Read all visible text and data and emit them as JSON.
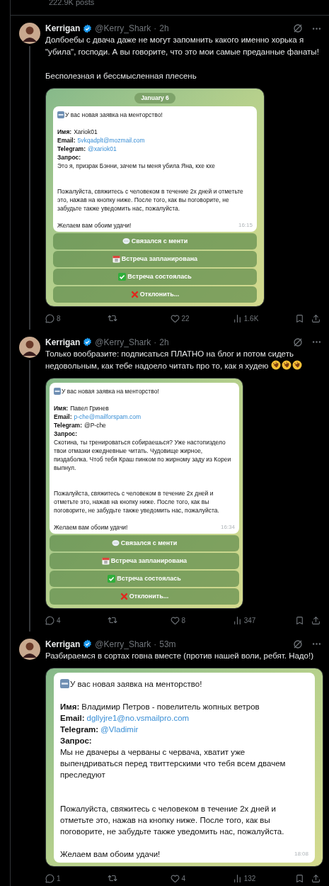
{
  "header": {
    "posts": "222.9K posts"
  },
  "tweets": [
    {
      "author": "Kerrigan",
      "verified": true,
      "handle": "@Kerry_Shark",
      "dot": "·",
      "time": "2h",
      "thread_line": true,
      "paragraphs": [
        "Долбоебы с двача даже не могут запомнить какого именно хорька я \"убила\", господи. А вы говорите, что это мои самые преданные фанаты!",
        "Бесполезная и бессмысленная плесень"
      ],
      "message": {
        "date": "January 6",
        "title": "У вас новая заявка на менторство!",
        "fields": [
          {
            "label": "Имя:",
            "value": "Xariok01",
            "link": false
          },
          {
            "label": "Email:",
            "value": "5vkqadplt@mozmail.com",
            "link": true
          },
          {
            "label": "Telegram:",
            "value": "@xariok01",
            "link": true
          }
        ],
        "request_label": "Запрос:",
        "request": "Это я, призрак Бэнни, зачем ты меня убила Яна, кхе кхе",
        "body": "Пожалуйста, свяжитесь с человеком в течение 2х дней и отметьте это, нажав на кнопку ниже. После того, как вы поговорите, не забудьте также уведомить нас, пожалуйста.",
        "closing": "Желаем вам обоим удачи!",
        "time": "16:15",
        "buttons": [
          {
            "kind": "chat",
            "label": "Связался с менти"
          },
          {
            "kind": "calendar",
            "label": "Встреча запланирована"
          },
          {
            "kind": "check",
            "label": "Встреча состоялась"
          },
          {
            "kind": "cross",
            "label": "Отклонить..."
          }
        ]
      },
      "stats": {
        "replies": "8",
        "likes": "22",
        "views": "1.6K"
      }
    },
    {
      "author": "Kerrigan",
      "verified": true,
      "handle": "@Kerry_Shark",
      "dot": "·",
      "time": "2h",
      "thread_line": true,
      "paragraphs": [
        "Только вообразите: подписаться ПЛАТНО на блог и потом сидеть недовольным, как тебе надоело читать про то, как я худею"
      ],
      "reactions": [
        {
          "kind": "rolling-laugh"
        },
        {
          "kind": "rolling-laugh"
        },
        {
          "kind": "rolling-laugh"
        }
      ],
      "message": {
        "title": "У вас новая заявка на менторство!",
        "fields": [
          {
            "label": "Имя:",
            "value": "Павел Гринев",
            "link": false
          },
          {
            "label": "Email:",
            "value": "p-che@mailforspam.com",
            "link": true
          },
          {
            "label": "Telegram:",
            "value": "@P-che",
            "link": false
          }
        ],
        "request_label": "Запрос:",
        "request": "Скотина, ты тренироваться собираешься? Уже настопиздело твои отмазки ежедневные читать. Чудовище жирное, пиздаболка. Чтоб тебя Краш пинком по жирному заду из Кореи выпнул.",
        "body": "Пожалуйста, свяжитесь с человеком в течение 2х дней и отметьте это, нажав на кнопку ниже. После того, как вы поговорите, не забудьте также уведомить нас, пожалуйста.",
        "closing": "Желаем вам обоим удачи!",
        "time": "16:34",
        "buttons": [
          {
            "kind": "chat",
            "label": "Связался с менти"
          },
          {
            "kind": "calendar",
            "label": "Встреча запланирована"
          },
          {
            "kind": "check",
            "label": "Встреча состоялась"
          },
          {
            "kind": "cross",
            "label": "Отклонить..."
          }
        ]
      },
      "stats": {
        "replies": "4",
        "likes": "8",
        "views": "347"
      }
    },
    {
      "author": "Kerrigan",
      "verified": true,
      "handle": "@Kerry_Shark",
      "dot": "·",
      "time": "53m",
      "thread_line": false,
      "paragraphs": [
        "Разбираемся в сортах говна вместе (против нашей воли, ребят. Надо!)"
      ],
      "message": {
        "title": "У вас новая заявка на менторство!",
        "fields": [
          {
            "label": "Имя:",
            "value": "Владимир Петров - повелитель жопных ветров",
            "link": false
          },
          {
            "label": "Email:",
            "value": "dgllyjre1@no.vsmailpro.com",
            "link": true
          },
          {
            "label": "Telegram:",
            "value": "@Vladimir",
            "link": true
          }
        ],
        "request_label": "Запрос:",
        "request": "Мы не двачеры а черваны с червача, хватит уже выпендриваться перед твиттерскими что тебя всем двачем преследуют",
        "body": "Пожалуйста, свяжитесь с человеком в течение 2х дней и отметьте это, нажав на кнопку ниже. После того, как вы поговорите, не забудьте также уведомить нас, пожалуйста.",
        "closing": "Желаем вам обоим удачи!",
        "time": "18:08"
      },
      "stats": {
        "replies": "1",
        "likes": "4",
        "views": "132"
      }
    }
  ]
}
